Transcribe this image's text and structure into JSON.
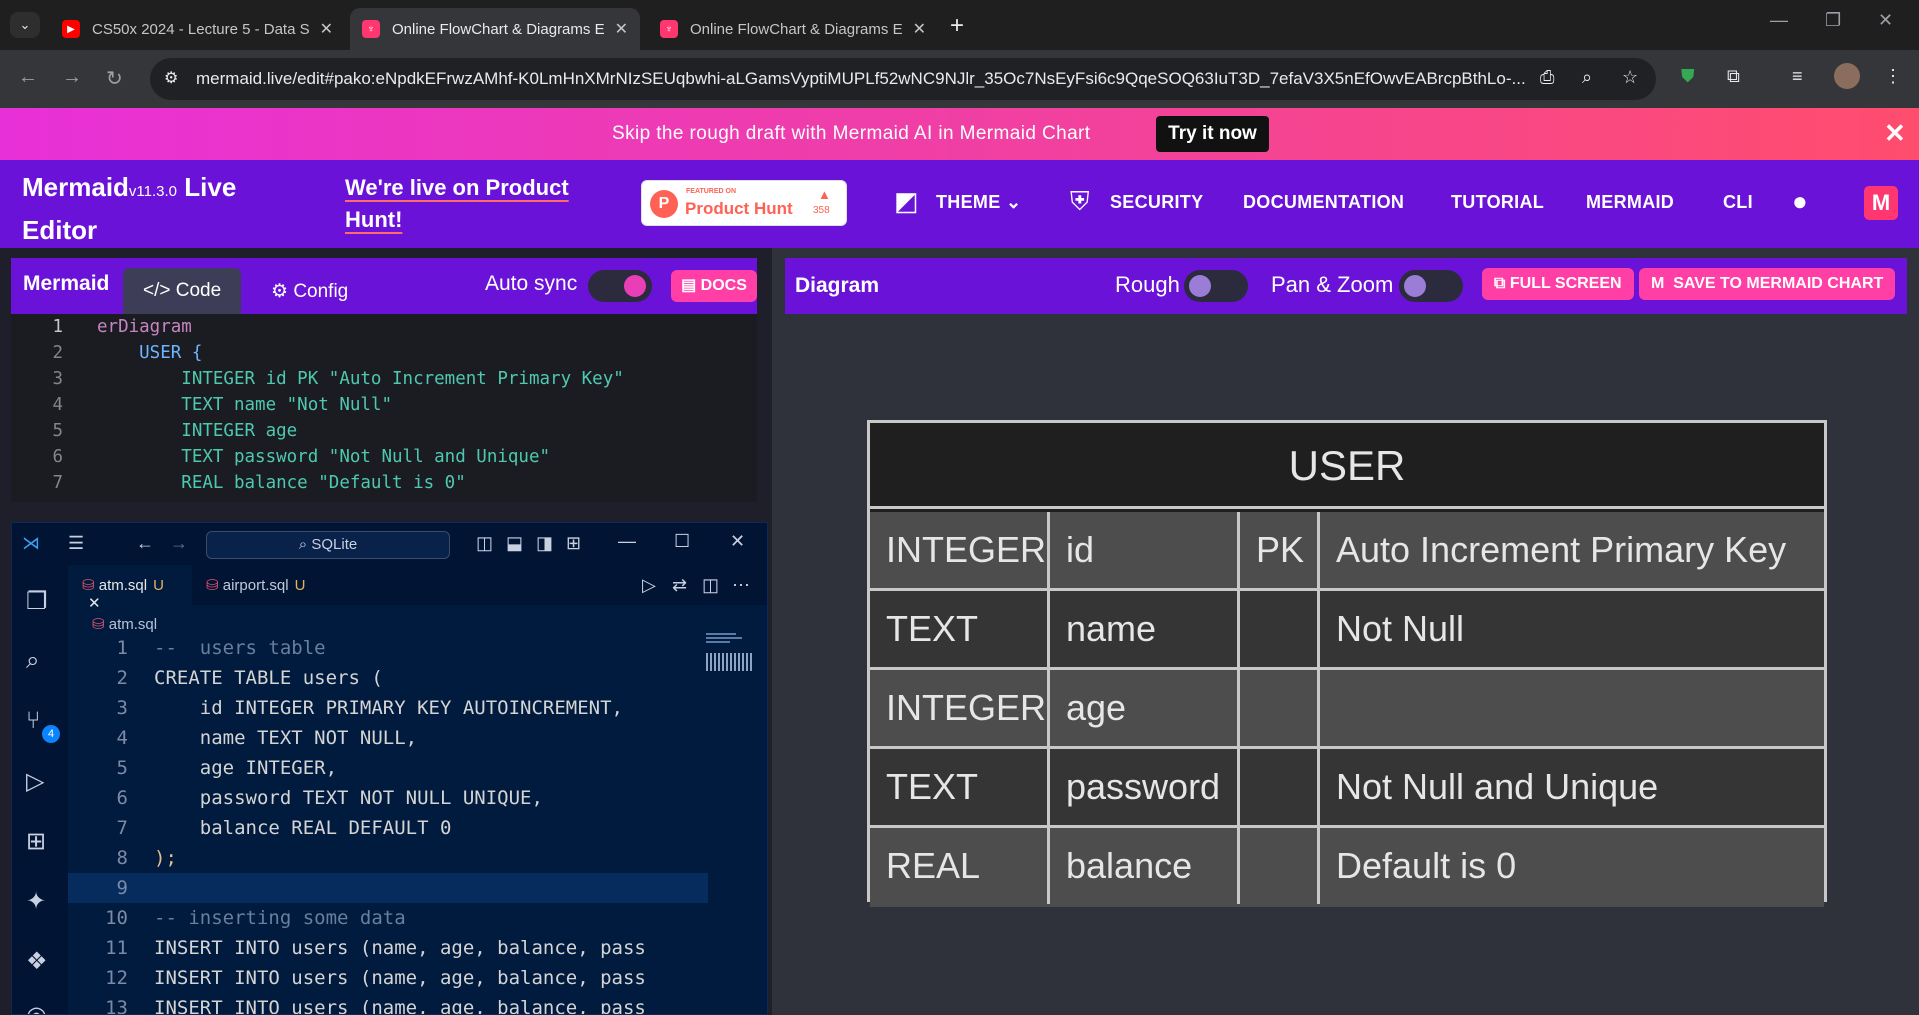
{
  "browser": {
    "tabs": [
      {
        "title": "CS50x 2024 - Lecture 5 - Data S",
        "active": false,
        "favicon": "youtube-icon"
      },
      {
        "title": "Online FlowChart & Diagrams E",
        "active": true,
        "favicon": "mermaid-icon"
      },
      {
        "title": "Online FlowChart & Diagrams E",
        "active": false,
        "favicon": "mermaid-icon"
      }
    ],
    "url": "mermaid.live/edit#pako:eNpdkEFrwzAMhf-K0LmHnXMrNIzSEUqbwhi-aLGamsVyptiMUPLf52wNC9NJlr_35Oc7NsEyFsi6c9QqeSOQ63IuT3D_7efaV3X5nEfOwvEABrcpBthLo-..."
  },
  "banner": {
    "message": "Skip the rough draft with Mermaid AI in Mermaid Chart",
    "button": "Try it now"
  },
  "header": {
    "brand": "Mermaid",
    "version": "v11.3.0",
    "brand_suffix": "Live Editor",
    "hunt_link": "We're live on Product Hunt!",
    "ph_featured": "FEATURED ON",
    "ph_name": "Product Hunt",
    "ph_votes": "358",
    "nav": [
      "THEME",
      "SECURITY",
      "DOCUMENTATION",
      "TUTORIAL",
      "MERMAID",
      "CLI"
    ]
  },
  "editor": {
    "label": "Mermaid",
    "tabs": [
      "Code",
      "Config"
    ],
    "autosync_label": "Auto sync",
    "docs_label": "DOCS",
    "lines": [
      {
        "n": "1",
        "text": "erDiagram"
      },
      {
        "n": "2",
        "text": "    USER {"
      },
      {
        "n": "3",
        "text": "        INTEGER id PK \"Auto Increment Primary Key\""
      },
      {
        "n": "4",
        "text": "        TEXT name \"Not Null\""
      },
      {
        "n": "5",
        "text": "        INTEGER age"
      },
      {
        "n": "6",
        "text": "        TEXT password \"Not Null and Unique\""
      },
      {
        "n": "7",
        "text": "        REAL balance \"Default is 0\""
      }
    ]
  },
  "vscode": {
    "search": "SQLite",
    "tabs": [
      {
        "name": "atm.sql",
        "status": "U"
      },
      {
        "name": "airport.sql",
        "status": "U"
      }
    ],
    "breadcrumb": "atm.sql",
    "scm_badge": "4",
    "lines": [
      {
        "n": "1",
        "text": "--  users table"
      },
      {
        "n": "2",
        "text": "CREATE TABLE users ("
      },
      {
        "n": "3",
        "text": "    id INTEGER PRIMARY KEY AUTOINCREMENT,"
      },
      {
        "n": "4",
        "text": "    name TEXT NOT NULL,"
      },
      {
        "n": "5",
        "text": "    age INTEGER,"
      },
      {
        "n": "6",
        "text": "    password TEXT NOT NULL UNIQUE,"
      },
      {
        "n": "7",
        "text": "    balance REAL DEFAULT 0"
      },
      {
        "n": "8",
        "text": ");"
      },
      {
        "n": "9",
        "text": ""
      },
      {
        "n": "10",
        "text": "-- inserting some data"
      },
      {
        "n": "11",
        "text": "INSERT INTO users (name, age, balance, pass"
      },
      {
        "n": "12",
        "text": "INSERT INTO users (name, age, balance, pass"
      },
      {
        "n": "13",
        "text": "INSERT INTO users (name, age, balance, pass"
      }
    ]
  },
  "diagram": {
    "label": "Diagram",
    "rough_label": "Rough",
    "panzoom_label": "Pan & Zoom",
    "fullscreen": "FULL SCREEN",
    "save": "SAVE TO MERMAID CHART",
    "entity": {
      "name": "USER",
      "rows": [
        {
          "type": "INTEGER",
          "name": "id",
          "key": "PK",
          "comment": "Auto Increment Primary Key"
        },
        {
          "type": "TEXT",
          "name": "name",
          "key": "",
          "comment": "Not Null"
        },
        {
          "type": "INTEGER",
          "name": "age",
          "key": "",
          "comment": ""
        },
        {
          "type": "TEXT",
          "name": "password",
          "key": "",
          "comment": "Not Null and Unique"
        },
        {
          "type": "REAL",
          "name": "balance",
          "key": "",
          "comment": "Default is 0"
        }
      ]
    }
  },
  "colors": {
    "accent_purple": "#6a12d8",
    "accent_pink": "#ff3fa6",
    "banner_gradient": [
      "#e830d8",
      "#ff4d6e"
    ]
  }
}
